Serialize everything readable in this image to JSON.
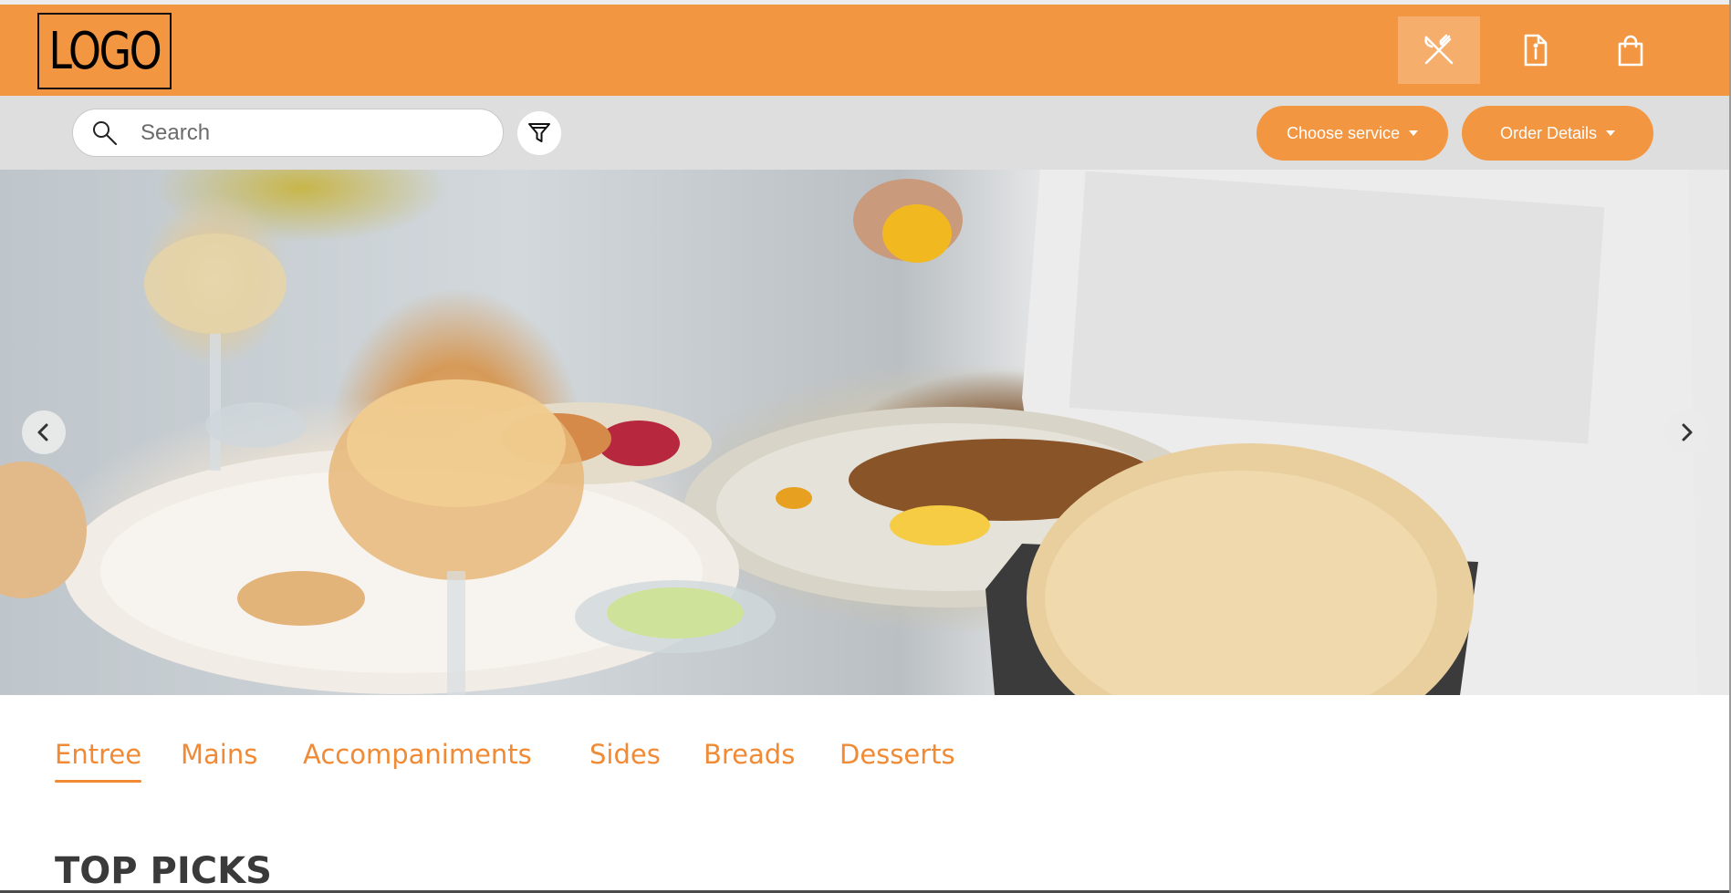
{
  "header": {
    "logo_text": "LOGO",
    "icons": [
      "utensils-icon",
      "document-info-icon",
      "shopping-bag-icon"
    ],
    "accent_color": "#f39642"
  },
  "toolbar": {
    "search": {
      "placeholder": "Search",
      "value": ""
    },
    "filter_icon": "filter-icon",
    "choose_service_label": "Choose service",
    "order_details_label": "Order Details"
  },
  "hero": {
    "prev_icon": "chevron-left-icon",
    "next_icon": "chevron-right-icon"
  },
  "tabs": [
    {
      "label": "Entree",
      "active": true
    },
    {
      "label": "Mains",
      "active": false
    },
    {
      "label": "Accompaniments",
      "active": false
    },
    {
      "label": "Sides",
      "active": false
    },
    {
      "label": "Breads",
      "active": false
    },
    {
      "label": "Desserts",
      "active": false
    }
  ],
  "section": {
    "title": "TOP PICKS"
  }
}
